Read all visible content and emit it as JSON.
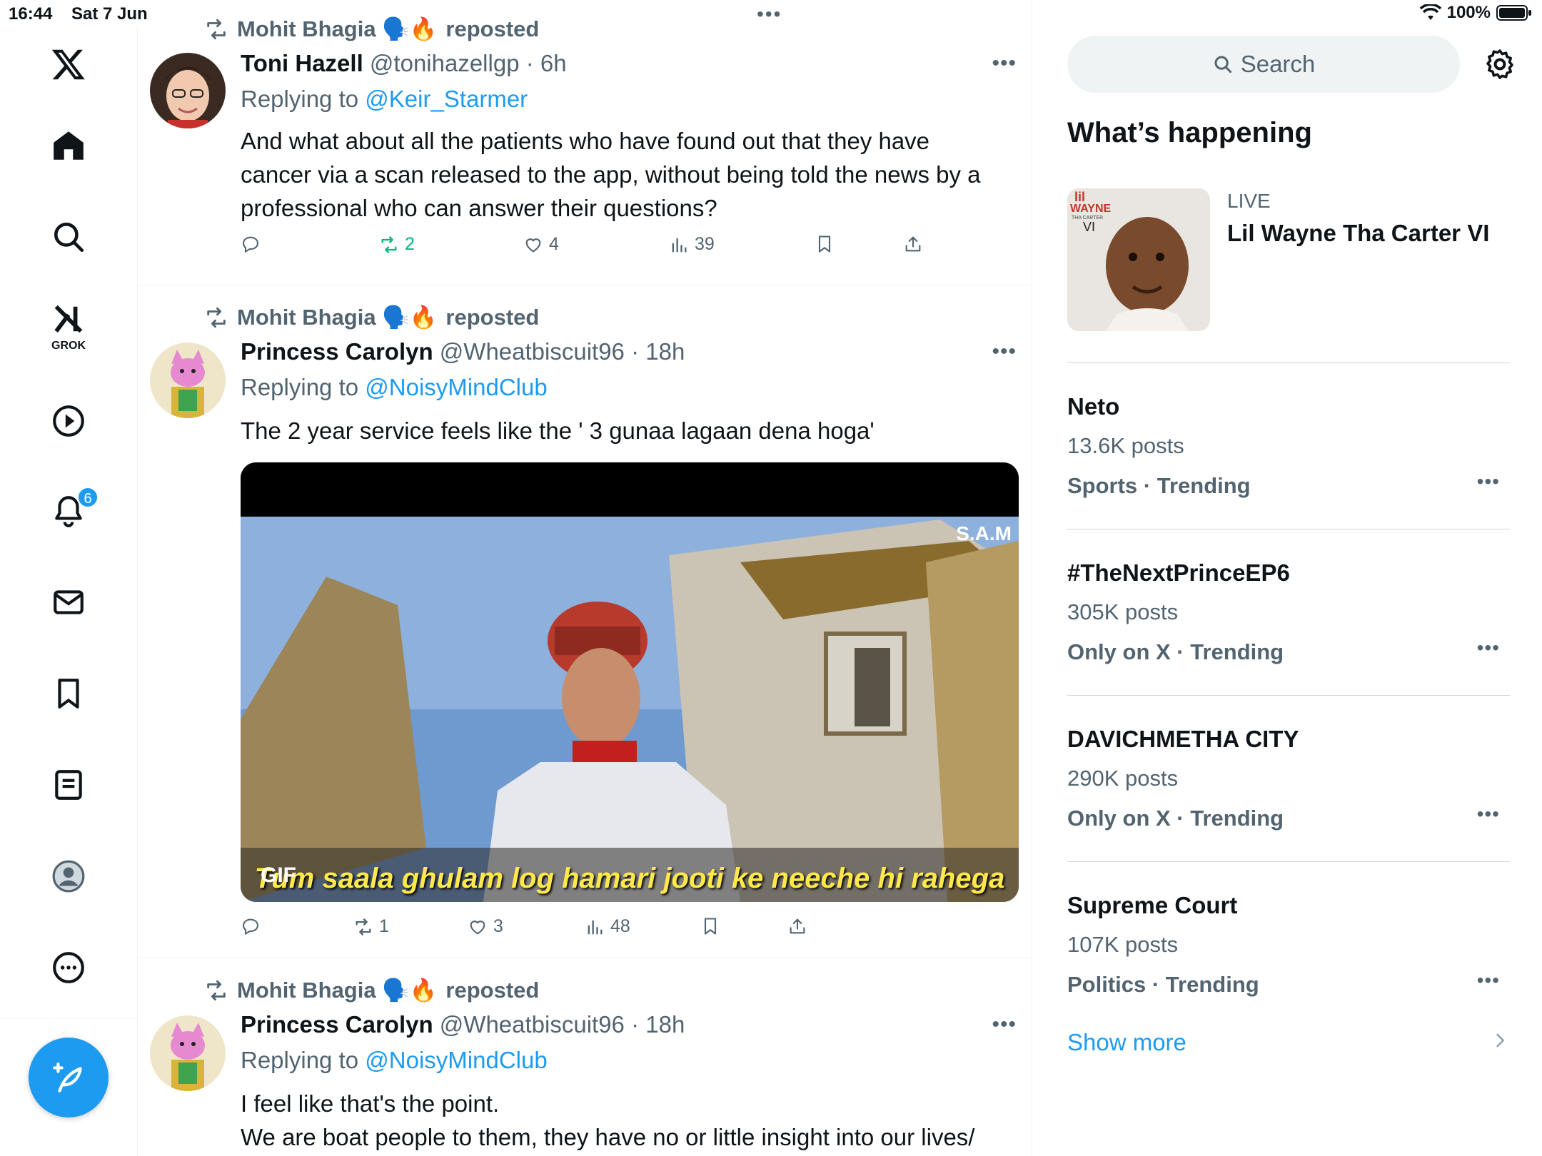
{
  "status_bar": {
    "time": "16:44",
    "date": "Sat 7 Jun",
    "battery": "100%"
  },
  "nav": {
    "grok_label": "GROK",
    "notifications_badge": "6"
  },
  "posts": [
    {
      "repost_by": "Mohit Bhagia 🗣️🔥",
      "repost_suffix": "reposted",
      "name": "Toni Hazell",
      "handle": "@tonihazellgp",
      "time": "6h",
      "reply_prefix": "Replying to",
      "reply_to": "@Keir_Starmer",
      "text_lines": [
        "And what about all the patients who have found out that they have",
        "cancer via a scan released to the app, without being told the news by a",
        "professional who can answer their questions?"
      ],
      "reposts": "2",
      "likes": "4",
      "views": "39"
    },
    {
      "repost_by": "Mohit Bhagia 🗣️🔥",
      "repost_suffix": "reposted",
      "name": "Princess Carolyn",
      "handle": "@Wheatbiscuit96",
      "time": "18h",
      "reply_prefix": "Replying to",
      "reply_to": "@NoisyMindClub",
      "text_lines": [
        "The 2 year service feels like the ' 3 gunaa lagaan dena hoga'"
      ],
      "media": {
        "badge": "GIF",
        "subtitle": "Tum saala ghulam log hamari jooti ke neeche hi rahega",
        "watermark": "S.A.M"
      },
      "reposts": "1",
      "likes": "3",
      "views": "48"
    },
    {
      "repost_by": "Mohit Bhagia 🗣️🔥",
      "repost_suffix": "reposted",
      "name": "Princess Carolyn",
      "handle": "@Wheatbiscuit96",
      "time": "18h",
      "reply_prefix": "Replying to",
      "reply_to": "@NoisyMindClub",
      "text_lines": [
        "I feel like that's the point.",
        "We are boat people to them, they have no or little insight into our lives/"
      ]
    }
  ],
  "sidebar": {
    "search_placeholder": "Search",
    "section_title": "What’s happening",
    "live": {
      "label": "LIVE",
      "title": "Lil Wayne Tha Carter VI",
      "thumb_text_top": "lil",
      "thumb_text_mid": "WAYNE",
      "thumb_text_small": "THA CARTER",
      "thumb_text_num": "VI"
    },
    "trends": [
      {
        "name": "Neto",
        "count": "13.6K posts",
        "category": "Sports · Trending"
      },
      {
        "name": "#TheNextPrinceEP6",
        "count": "305K posts",
        "category": "Only on X · Trending"
      },
      {
        "name": "DAVICHMETHA CITY",
        "count": "290K posts",
        "category": "Only on X · Trending"
      },
      {
        "name": "Supreme Court",
        "count": "107K posts",
        "category": "Politics · Trending"
      }
    ],
    "show_more": "Show more"
  },
  "colors": {
    "accent": "#1d9bf0",
    "muted": "#536471",
    "repost_green": "#00ba7c"
  }
}
